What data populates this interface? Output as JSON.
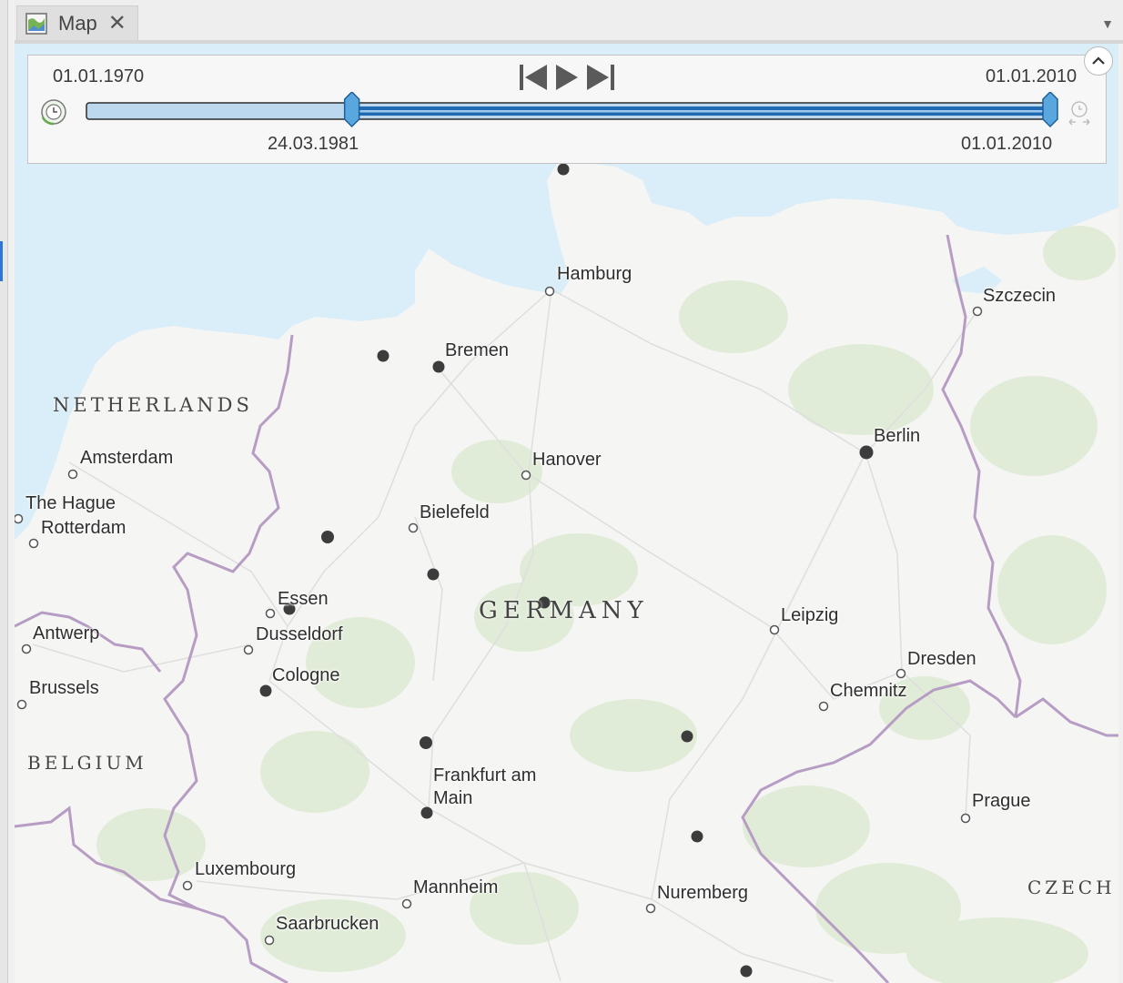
{
  "tab": {
    "title": "Map",
    "close": "✕",
    "menu": "▼"
  },
  "time_slider": {
    "start_label": "01.01.1970",
    "end_label": "01.01.2010",
    "current_start": "24.03.1981",
    "current_end": "01.01.2010",
    "current_start_fraction": 0.27,
    "current_end_fraction": 1.0,
    "controls": [
      "previous-icon",
      "play-icon",
      "next-icon"
    ]
  },
  "map": {
    "countries": [
      "NETHERLANDS",
      "BELGIUM",
      "GERMANY",
      "CZECH"
    ],
    "cities": [
      "Hamburg",
      "Szczecin",
      "Bremen",
      "Amsterdam",
      "Berlin",
      "Hanover",
      "The Hague",
      "Rotterdam",
      "Bielefeld",
      "Essen",
      "Antwerp",
      "Dusseldorf",
      "Leipzig",
      "Dresden",
      "Cologne",
      "Brussels",
      "Chemnitz",
      "Frankfurt am Main",
      "Prague",
      "Luxembourg",
      "Mannheim",
      "Nuremberg",
      "Saarbrucken"
    ],
    "colors": {
      "water": "#d9eef8",
      "land": "#f5f5f3",
      "forest": "#e3eddc",
      "border": "#b79cc4",
      "event_point": "#3c3c3c",
      "slider_fill": "#1f6ab2",
      "slider_track": "#bcd8ee"
    }
  }
}
